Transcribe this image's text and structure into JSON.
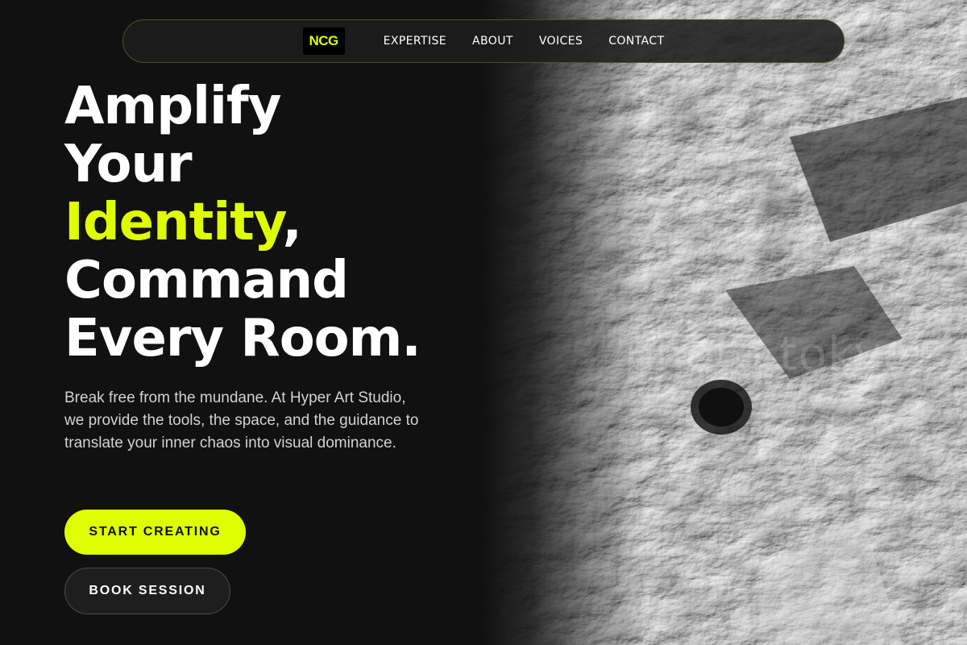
{
  "nav": {
    "logo": "NCG",
    "links": [
      "EXPERTISE",
      "ABOUT",
      "VOICES",
      "CONTACT"
    ]
  },
  "hero": {
    "line1": "Amplify",
    "line2": "Your",
    "line3_accent": "Identity",
    "line3_rest": ",",
    "line4": "Command",
    "line5": "Every Room.",
    "description": "Break free from the mundane. At Hyper Art Studio, we provide the tools, the space, and the guidance to translate your inner chaos into visual dominance.",
    "primary_button": "START CREATING",
    "secondary_button": "BOOK SESSION"
  },
  "art": {
    "watermark": "photo tokyo"
  },
  "colors": {
    "accent": "#dfff00",
    "background": "#111111"
  }
}
